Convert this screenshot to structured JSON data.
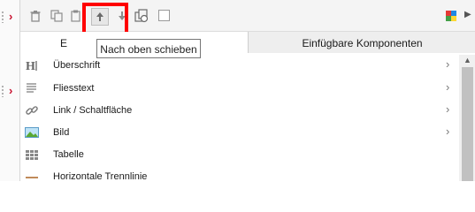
{
  "toolbar": {
    "icons": [
      "trash-icon",
      "copy-icon",
      "paste-icon",
      "move-up-icon",
      "move-down-icon",
      "duplicate-icon",
      "checkbox",
      "components-icon",
      "expand-icon"
    ]
  },
  "tooltip": "Nach oben schieben",
  "tabs": [
    {
      "label": "E"
    },
    {
      "label": "Einfügbare Komponenten"
    }
  ],
  "items": [
    {
      "label": "Überschrift",
      "icon": "heading-icon",
      "has_submenu": true
    },
    {
      "label": "Fliesstext",
      "icon": "paragraph-icon",
      "has_submenu": true
    },
    {
      "label": "Link / Schaltfläche",
      "icon": "link-icon",
      "has_submenu": true
    },
    {
      "label": "Bild",
      "icon": "image-icon",
      "has_submenu": true
    },
    {
      "label": "Tabelle",
      "icon": "table-icon",
      "has_submenu": false
    },
    {
      "label": "Horizontale Trennlinie",
      "icon": "divider-icon",
      "has_submenu": false
    }
  ],
  "colors": {
    "highlight": "#ff0000",
    "accent_red": "#c8102e"
  }
}
